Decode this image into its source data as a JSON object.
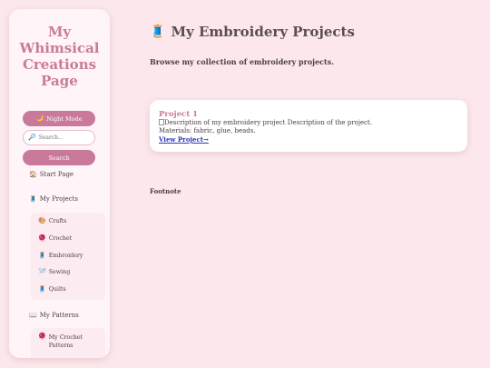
{
  "sidebar": {
    "title": "My Whimsical Creations Page",
    "night_mode_label": "Night Mode",
    "night_mode_icon": "🌙",
    "search_icon": "🔎",
    "search_placeholder": "Search...",
    "search_button_label": "Search",
    "nav": {
      "start": {
        "icon": "🏠",
        "label": "Start Page"
      },
      "projects": {
        "icon": "🧵",
        "label": "My Projects"
      },
      "patterns": {
        "icon": "📖",
        "label": "My Patterns"
      }
    },
    "project_items": [
      {
        "icon": "🎨",
        "label": "Crafts"
      },
      {
        "icon": "🧶",
        "label": "Crochet"
      },
      {
        "icon": "🧵",
        "label": "Embroidery"
      },
      {
        "icon": "🪡",
        "label": "Sewing"
      },
      {
        "icon": "🧵",
        "label": "Quilts"
      }
    ],
    "pattern_items": [
      {
        "icon": "🧶",
        "label": "My Crochet Patterns"
      }
    ]
  },
  "main": {
    "title_icon": "🧵",
    "title": "My Embroidery Projects",
    "subtitle": "Browse my collection of embroidery projects.",
    "card": {
      "title": "Project 1",
      "image_alt_text": "Description of my embroidery project",
      "description": "Description of the project.",
      "materials": "Materials: fabric, glue, beads.",
      "link_label": "View Project→"
    },
    "footnote": "Footnote"
  },
  "colors": {
    "background": "#fce8ec",
    "accent": "#c9799a",
    "title": "#c97b97",
    "link": "#2c3ab8"
  }
}
